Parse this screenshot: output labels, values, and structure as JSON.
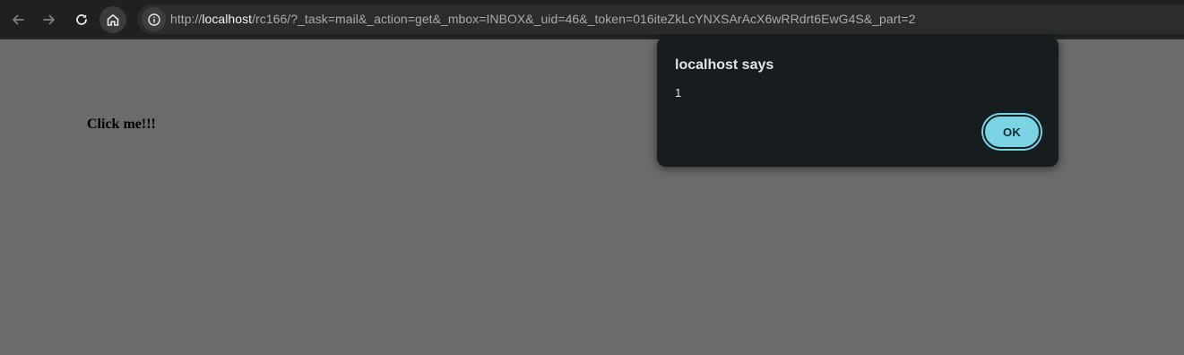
{
  "browser": {
    "url_scheme": "http://",
    "url_host": "localhost",
    "url_path": "/rc166/?_task=mail&_action=get&_mbox=INBOX&_uid=46&_token=016iteZkLcYNXSArAcX6wRRdrt6EwG4S&_part=2",
    "icons": [
      "back-arrow-icon",
      "forward-arrow-icon",
      "reload-icon",
      "home-icon",
      "site-info-icon"
    ]
  },
  "page": {
    "link_text": "Click me!!!",
    "background_color": "#6b6b6b"
  },
  "alert": {
    "title": "localhost says",
    "message": "1",
    "ok_label": "OK",
    "accent_color": "#7ad4e4"
  }
}
